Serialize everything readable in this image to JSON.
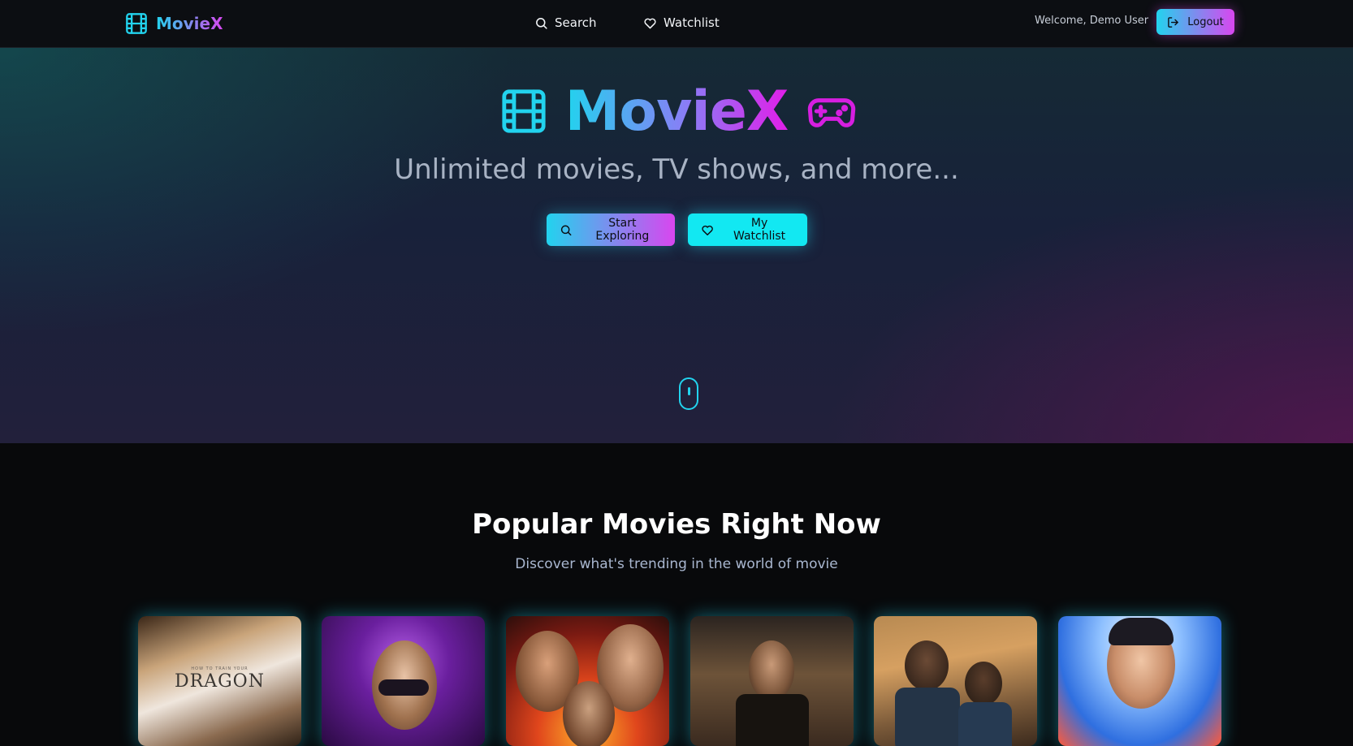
{
  "nav": {
    "brand": "MovieX",
    "links": [
      {
        "label": "Search",
        "icon": "search-icon"
      },
      {
        "label": "Watchlist",
        "icon": "heart-icon"
      }
    ],
    "welcome": "Welcome, Demo User",
    "logout_label": "Logout"
  },
  "hero": {
    "title": "MovieX",
    "subtitle": "Unlimited movies, TV shows, and more...",
    "explore_label": "Start Exploring",
    "watchlist_label": "My Watchlist"
  },
  "popular": {
    "title": "Popular Movies Right Now",
    "subtitle": "Discover what's trending in the world of movie",
    "posters": [
      {
        "tagline": "HOW TO TRAIN YOUR",
        "word": "DRAGON"
      },
      {
        "tagline": "",
        "word": ""
      },
      {
        "tagline": "",
        "word": ""
      },
      {
        "tagline": "",
        "word": ""
      },
      {
        "tagline": "",
        "word": ""
      },
      {
        "tagline": "",
        "word": ""
      }
    ]
  },
  "colors": {
    "accent_cyan": "#22d3ee",
    "accent_magenta": "#d946ef",
    "background": "#08090b"
  }
}
